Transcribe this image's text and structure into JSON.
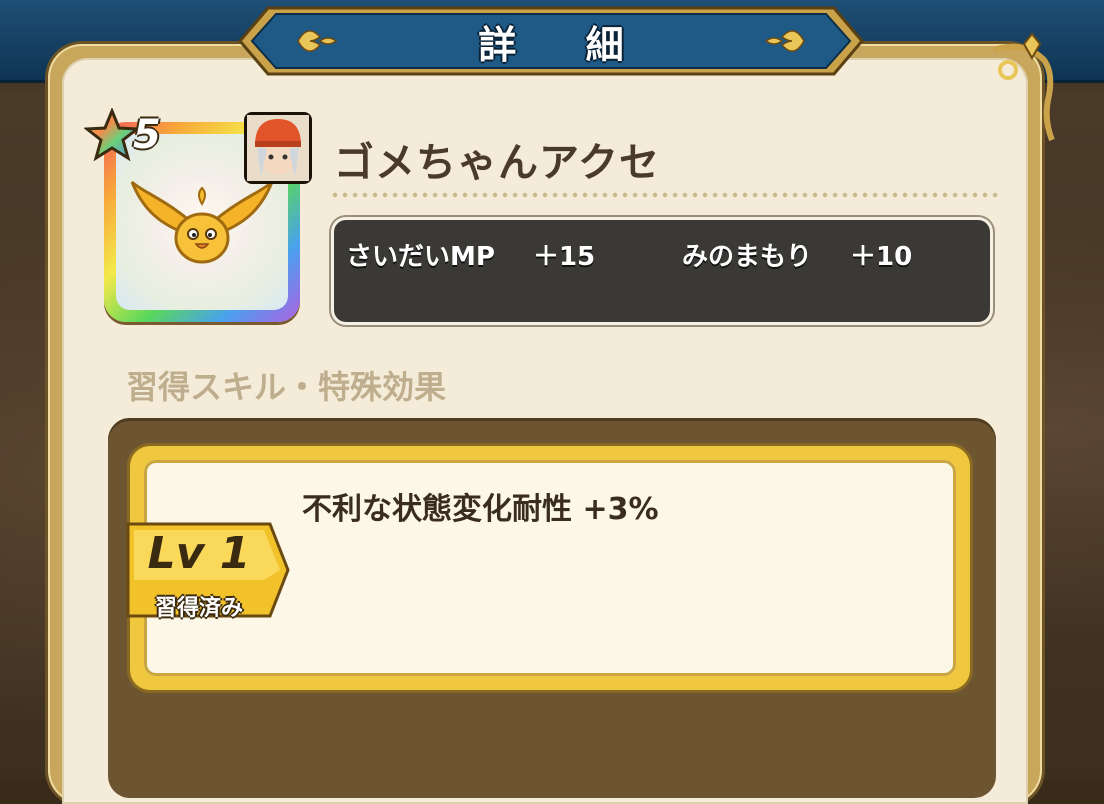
{
  "header": {
    "title": "詳 細"
  },
  "item": {
    "rarity": "5",
    "name": "ゴメちゃんアクセ",
    "icon": "golden-slime-bird-icon",
    "character_icon": "character-portrait-icon"
  },
  "stats": [
    {
      "label": "さいだいMP",
      "value": "＋15"
    },
    {
      "label": "みのまもり",
      "value": "＋10"
    }
  ],
  "section": {
    "label": "習得スキル・特殊効果"
  },
  "skills": [
    {
      "level": "Lv 1",
      "status": "習得済み",
      "effect": "不利な状態変化耐性 +3%"
    }
  ],
  "colors": {
    "header_blue": "#1e4f76",
    "panel_cream": "#f4ecd8",
    "stat_box": "#3b3935",
    "skill_gold": "#f0c840"
  }
}
